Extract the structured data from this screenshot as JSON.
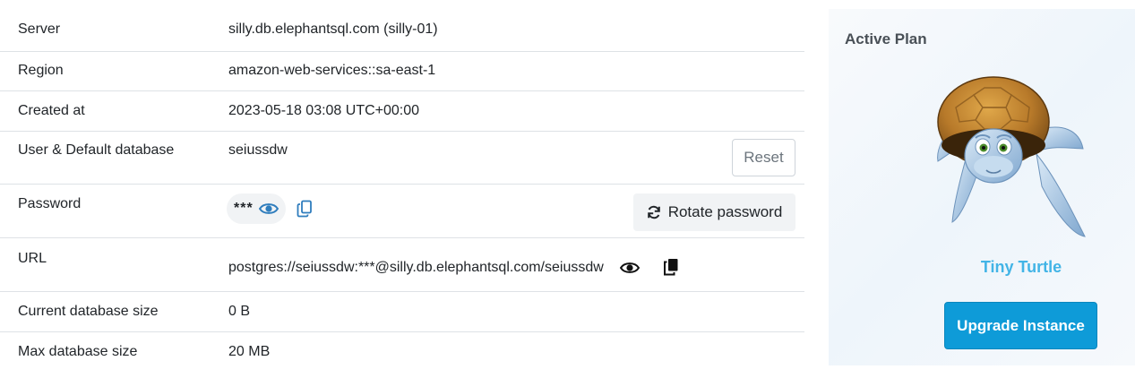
{
  "details": {
    "server": {
      "label": "Server",
      "value": "silly.db.elephantsql.com (silly-01)"
    },
    "region": {
      "label": "Region",
      "value": "amazon-web-services::sa-east-1"
    },
    "created": {
      "label": "Created at",
      "value": "2023-05-18 03:08 UTC+00:00"
    },
    "user": {
      "label": "User & Default database",
      "value": "seiussdw",
      "reset_label": "Reset"
    },
    "password": {
      "label": "Password",
      "masked": "***",
      "rotate_label": "Rotate password",
      "reveal_icon": "eye-icon",
      "copy_icon": "copy-icon",
      "rotate_icon": "refresh-icon"
    },
    "url": {
      "label": "URL",
      "value": "postgres://seiussdw:***@silly.db.elephantsql.com/seiussdw",
      "reveal_icon": "eye-icon",
      "copy_icon": "copy-icon"
    },
    "current_size": {
      "label": "Current database size",
      "value": "0 B"
    },
    "max_size": {
      "label": "Max database size",
      "value": "20 MB"
    }
  },
  "plan": {
    "title": "Active Plan",
    "name": "Tiny Turtle",
    "upgrade_label": "Upgrade Instance",
    "mascot": "turtle-illustration"
  },
  "colors": {
    "accent": "#0e9bd8",
    "plan_name": "#42b4e6",
    "icon_blue": "#2f7dbd"
  }
}
